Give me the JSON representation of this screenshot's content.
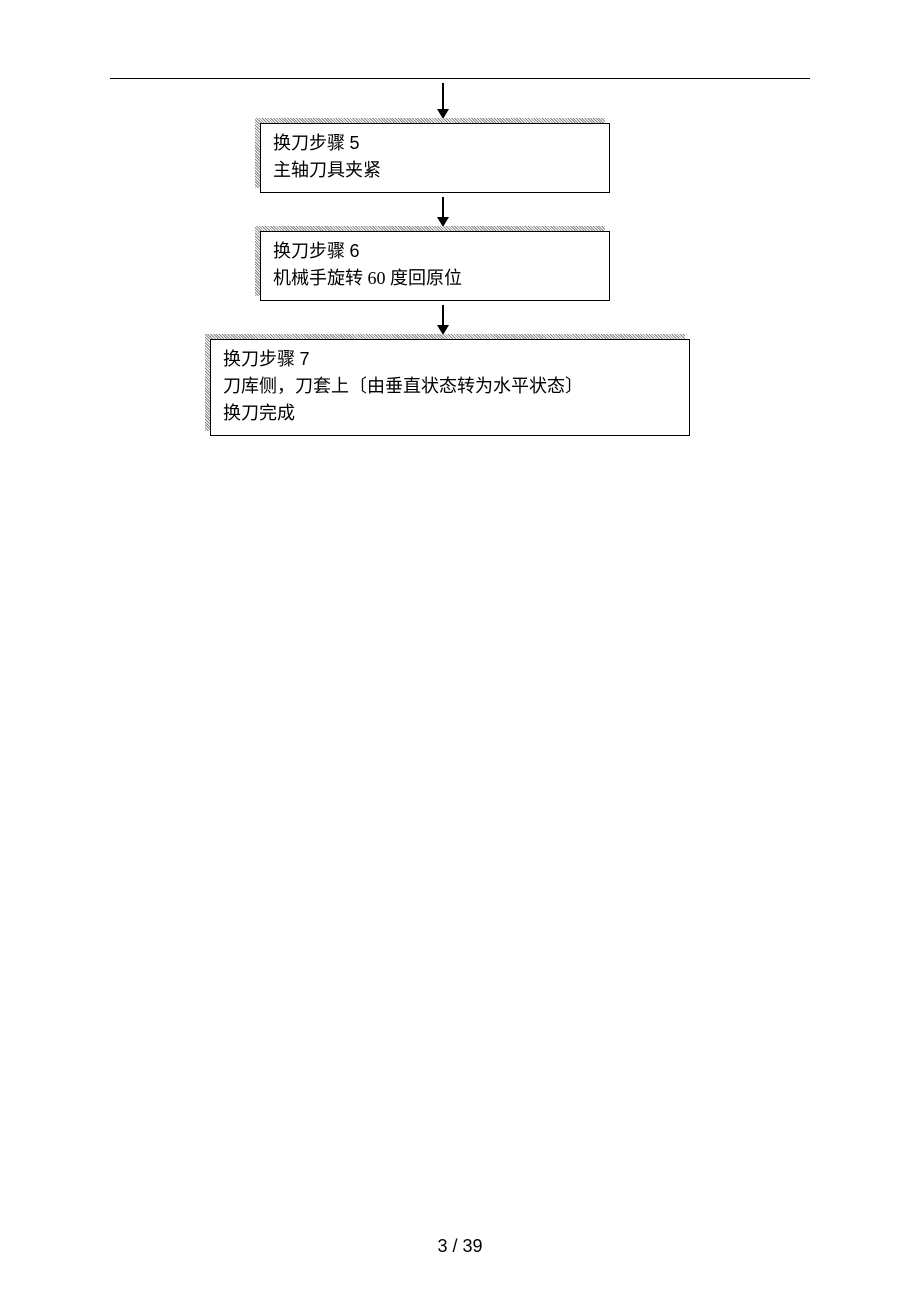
{
  "page_number": "3 / 39",
  "steps": [
    {
      "title_prefix": "换刀步骤 ",
      "title_num": "5",
      "body": "主轴刀具夹紧"
    },
    {
      "title_prefix": "换刀步骤 ",
      "title_num": "6",
      "body": "机械手旋转 60 度回原位"
    },
    {
      "title_prefix": "换刀步骤 ",
      "title_num": "7",
      "body": "刀库侧，刀套上〔由垂直状态转为水平状态〕",
      "body2": "换刀完成"
    }
  ]
}
